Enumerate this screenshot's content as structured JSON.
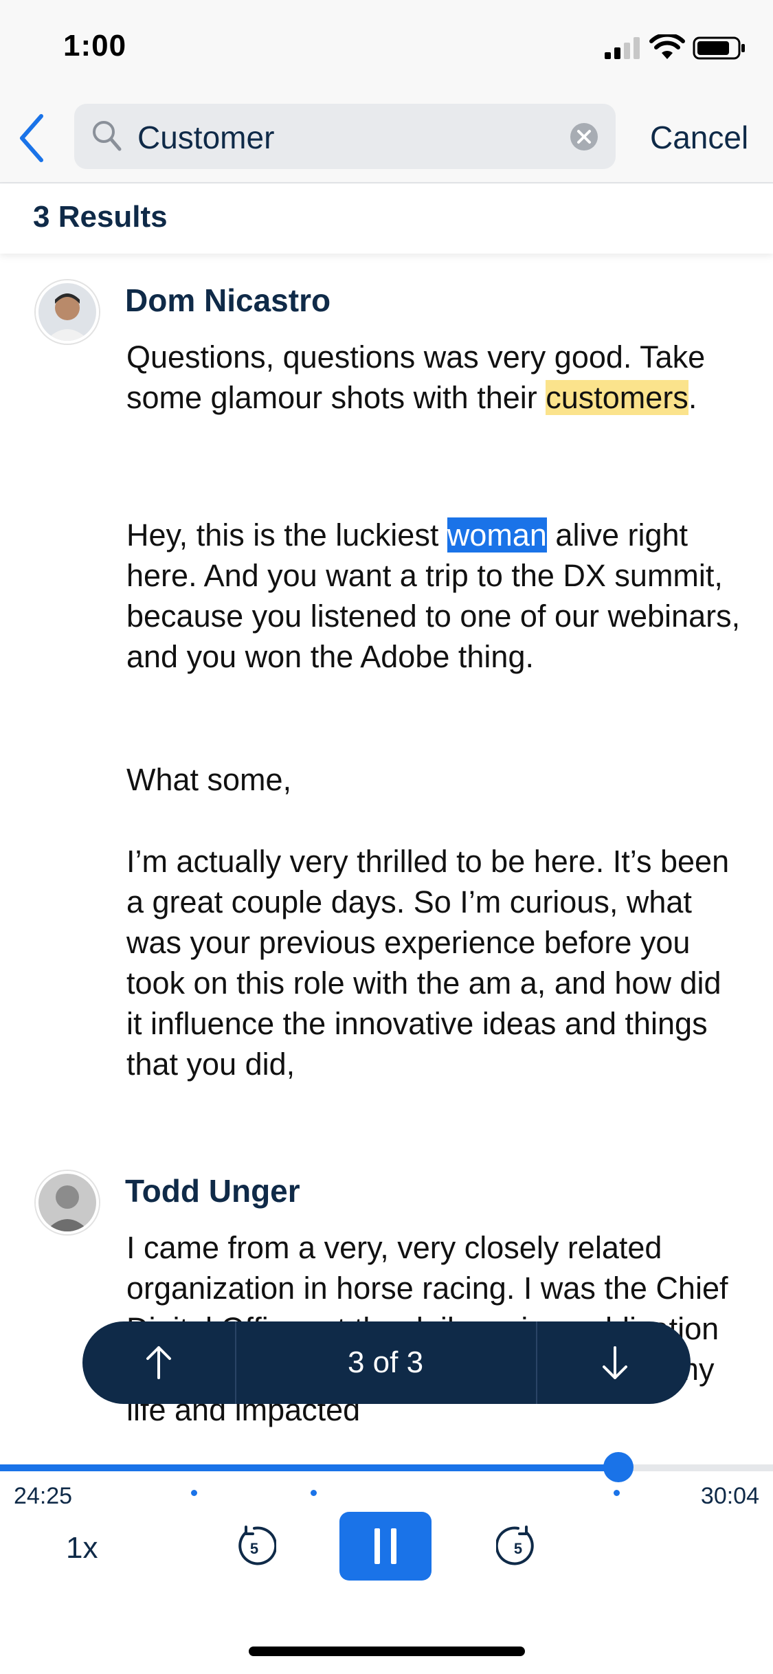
{
  "status_bar": {
    "time": "1:00"
  },
  "search": {
    "query": "Customer",
    "cancel_label": "Cancel"
  },
  "results": {
    "count_label": "3 Results"
  },
  "transcript": [
    {
      "speaker": "Dom Nicastro",
      "paragraphs": [
        {
          "before": "Questions, questions was very good. Take some glamour shots with their ",
          "match": "customers",
          "after": "."
        },
        {
          "before": "Hey, this is the luckiest ",
          "match": "woman",
          "after": " alive right here. And you want a trip to the DX summit, because you listened to one of our webinars, and you won the Adobe thing."
        },
        {
          "text": "What some,"
        },
        {
          "text": "I’m actually very thrilled to be here. It’s been a great couple days. So I’m curious, what was your previous experience before you took on this role with the am a, and how did it influence the innovative ideas and things that you did,"
        }
      ]
    },
    {
      "speaker": "Todd Unger",
      "paragraphs": [
        {
          "text": "I came from a very, very closely related organization in horse racing. I was the Chief Digital Officer at the daily racing publication in racing. And I would say that changed my life and impacted"
        }
      ]
    }
  ],
  "match_nav": {
    "position_label": "3 of 3",
    "up_icon": "arrow-up-icon",
    "down_icon": "arrow-down-icon"
  },
  "player": {
    "elapsed": "24:25",
    "duration": "30:04",
    "progress_fraction": 0.8,
    "speed_label": "1x",
    "rewind_seconds": "5",
    "forward_seconds": "5"
  },
  "colors": {
    "accent": "#1a73e8",
    "navy": "#0f2a48",
    "highlight": "#fbe38c"
  }
}
